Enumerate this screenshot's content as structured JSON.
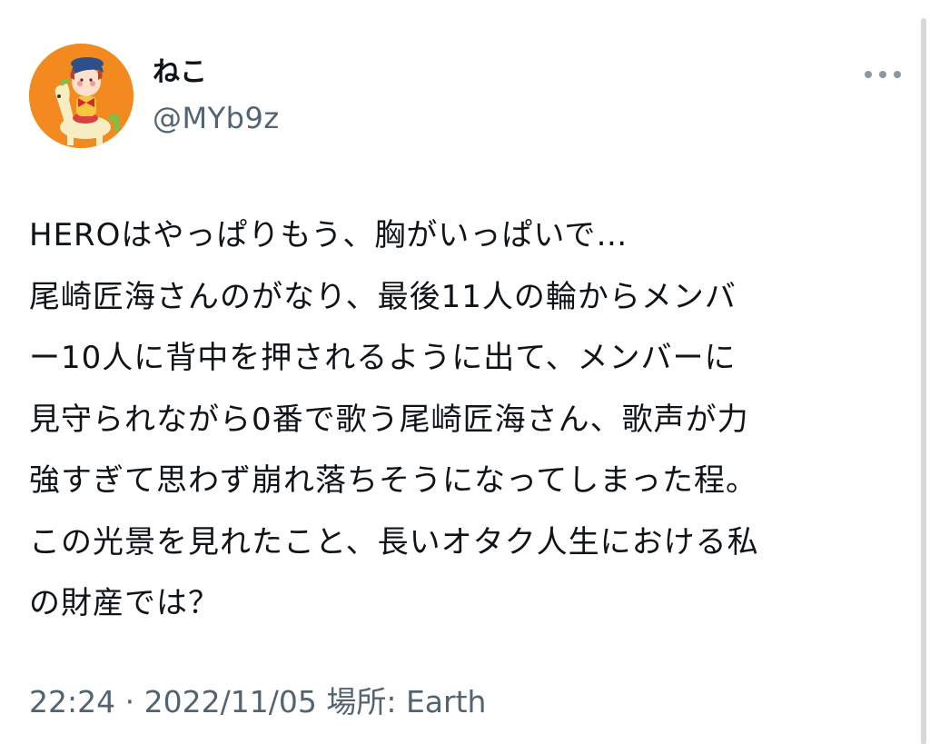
{
  "author": {
    "display_name": "ねこ",
    "handle": "@MYb9z",
    "avatar_icon": "avatar-cartoon-horse-rider",
    "avatar_bg": "#f28a1f"
  },
  "menu": {
    "more_icon": "more-dots-icon"
  },
  "tweet": {
    "lines": [
      "HEROはやっぱりもう、胸がいっぱいで…",
      "尾崎匠海さんのがなり、最後11人の輪からメンバ",
      "ー10人に背中を押されるように出て、メンバーに",
      "見守られながら0番で歌う尾崎匠海さん、歌声が力",
      "強すぎて思わず崩れ落ちそうになってしまった程。",
      "この光景を見れたこと、長いオタク人生における私",
      "の財産では？"
    ]
  },
  "meta": {
    "time": "22:24",
    "separator": "·",
    "date": "2022/11/05",
    "location_label": "場所:",
    "location": "Earth"
  },
  "colors": {
    "text": "#0f1419",
    "secondary": "#536471"
  }
}
